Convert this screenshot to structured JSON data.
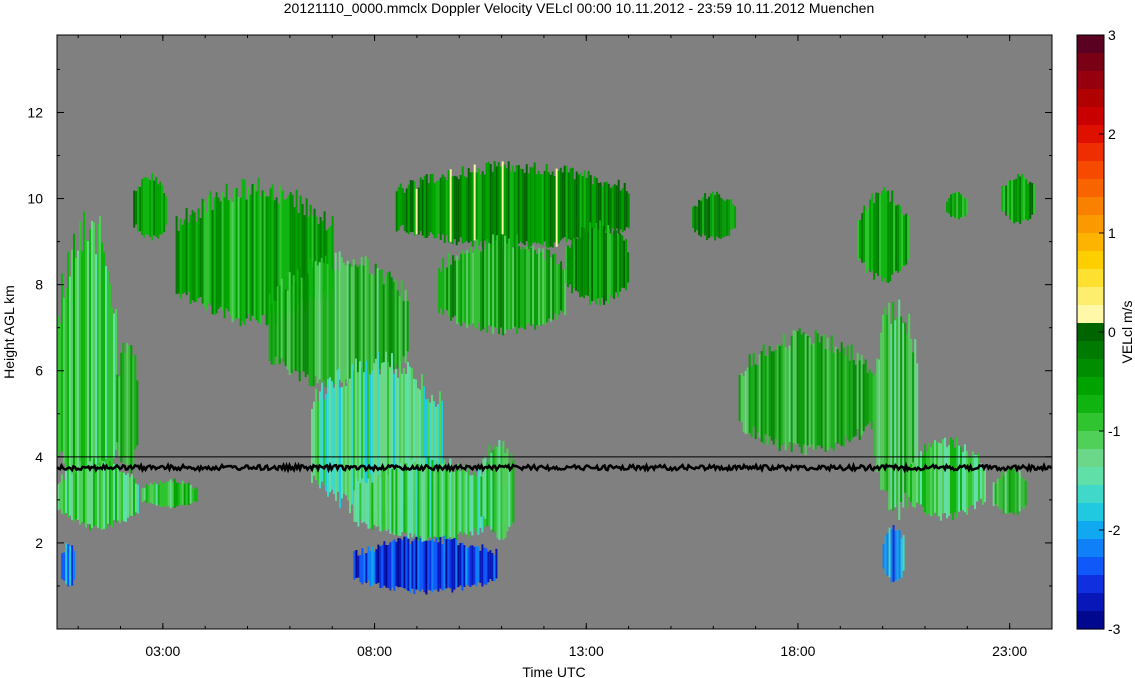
{
  "chart_data": {
    "type": "heatmap",
    "title": "20121110_0000.mmclx Doppler Velocity VELcl   00:00 10.11.2012 - 23:59 10.11.2012 Muenchen",
    "xlabel": "Time UTC",
    "ylabel": "Height AGL km",
    "colorbar_label": "VELcl m/s",
    "x_range_hours": [
      0.5,
      24
    ],
    "y_range_km": [
      0,
      13.8
    ],
    "x_ticks": [
      {
        "value": 3,
        "label": "03:00"
      },
      {
        "value": 8,
        "label": "08:00"
      },
      {
        "value": 13,
        "label": "13:00"
      },
      {
        "value": 18,
        "label": "18:00"
      },
      {
        "value": 23,
        "label": "23:00"
      }
    ],
    "y_ticks": [
      {
        "value": 2,
        "label": "2"
      },
      {
        "value": 4,
        "label": "4"
      },
      {
        "value": 6,
        "label": "6"
      },
      {
        "value": 8,
        "label": "8"
      },
      {
        "value": 10,
        "label": "10"
      },
      {
        "value": 12,
        "label": "12"
      }
    ],
    "colorbar_range": [
      -3,
      3
    ],
    "colorbar_ticks": [
      {
        "value": 3,
        "label": "3"
      },
      {
        "value": 2,
        "label": "2"
      },
      {
        "value": 1,
        "label": "1"
      },
      {
        "value": 0,
        "label": "0"
      },
      {
        "value": -1,
        "label": "-1"
      },
      {
        "value": -2,
        "label": "-2"
      },
      {
        "value": -3,
        "label": "-3"
      }
    ],
    "colorbar_colors": [
      "#5a0020",
      "#7a0016",
      "#96000e",
      "#b00000",
      "#c80000",
      "#de1000",
      "#ee2e00",
      "#f54a00",
      "#f86400",
      "#fa8000",
      "#fb9a00",
      "#fcb400",
      "#fdce00",
      "#fde030",
      "#fdee6e",
      "#fff8a8",
      "#006400",
      "#007a00",
      "#008e00",
      "#00a200",
      "#10b410",
      "#30c430",
      "#50d058",
      "#6ad888",
      "#60e0a8",
      "#40d8c8",
      "#20c8e0",
      "#10a8f0",
      "#1080f8",
      "#1058f8",
      "#1030e0",
      "#0818b8",
      "#000890"
    ],
    "background_color": "#808080",
    "reference_line_height_km": 4.0,
    "noise_band_height_km": 3.75,
    "echo_regions": [
      {
        "t": [
          0.5,
          1.9
        ],
        "z": [
          2.2,
          10.0
        ],
        "v": -1.0
      },
      {
        "t": [
          0.5,
          2.4
        ],
        "z": [
          2.3,
          4.0
        ],
        "v": -1.2
      },
      {
        "t": [
          1.9,
          2.4
        ],
        "z": [
          3.5,
          7.0
        ],
        "v": -1.0
      },
      {
        "t": [
          0.6,
          0.9
        ],
        "z": [
          0.9,
          2.1
        ],
        "v": -2.2
      },
      {
        "t": [
          2.5,
          3.8
        ],
        "z": [
          2.8,
          3.5
        ],
        "v": -1.0
      },
      {
        "t": [
          2.3,
          3.1
        ],
        "z": [
          9.0,
          10.6
        ],
        "v": -0.4
      },
      {
        "t": [
          3.3,
          7.0
        ],
        "z": [
          7.0,
          10.5
        ],
        "v": -0.6
      },
      {
        "t": [
          5.5,
          8.8
        ],
        "z": [
          5.5,
          8.8
        ],
        "v": -0.8
      },
      {
        "t": [
          6.5,
          9.6
        ],
        "z": [
          2.5,
          6.5
        ],
        "v": -1.4
      },
      {
        "t": [
          7.5,
          11.1
        ],
        "z": [
          2.0,
          4.0
        ],
        "v": -1.2
      },
      {
        "t": [
          7.5,
          10.9
        ],
        "z": [
          0.8,
          2.2
        ],
        "v": -2.6
      },
      {
        "t": [
          8.5,
          14.0
        ],
        "z": [
          8.8,
          10.9
        ],
        "v": -0.3
      },
      {
        "t": [
          9.5,
          12.5
        ],
        "z": [
          6.8,
          9.2
        ],
        "v": -0.7
      },
      {
        "t": [
          10.5,
          11.3
        ],
        "z": [
          2.0,
          4.5
        ],
        "v": -1.1
      },
      {
        "t": [
          12.5,
          14.0
        ],
        "z": [
          7.5,
          9.5
        ],
        "v": -0.5
      },
      {
        "t": [
          15.5,
          16.5
        ],
        "z": [
          9.0,
          10.2
        ],
        "v": -0.4
      },
      {
        "t": [
          16.6,
          19.8
        ],
        "z": [
          4.0,
          7.0
        ],
        "v": -0.8
      },
      {
        "t": [
          19.4,
          20.6
        ],
        "z": [
          8.0,
          10.3
        ],
        "v": -0.5
      },
      {
        "t": [
          19.8,
          20.8
        ],
        "z": [
          2.4,
          8.0
        ],
        "v": -1.0
      },
      {
        "t": [
          20.0,
          20.5
        ],
        "z": [
          1.0,
          2.5
        ],
        "v": -2.1
      },
      {
        "t": [
          20.6,
          22.4
        ],
        "z": [
          2.5,
          4.5
        ],
        "v": -1.1
      },
      {
        "t": [
          22.6,
          23.4
        ],
        "z": [
          2.6,
          3.8
        ],
        "v": -1.0
      },
      {
        "t": [
          21.5,
          22.0
        ],
        "z": [
          9.5,
          10.2
        ],
        "v": -0.6
      },
      {
        "t": [
          22.8,
          23.6
        ],
        "z": [
          9.4,
          10.6
        ],
        "v": -0.5
      }
    ]
  }
}
